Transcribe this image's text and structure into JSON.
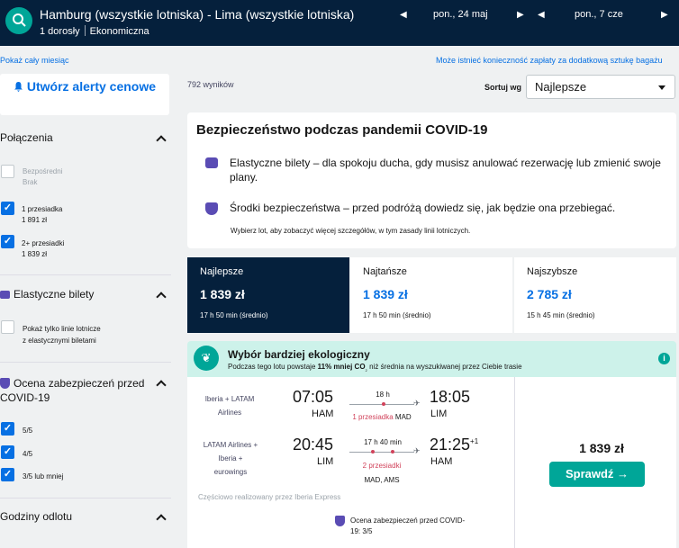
{
  "header": {
    "route": "Hamburg (wszystkie lotniska) - Lima (wszystkie lotniska)",
    "passengers": "1 dorosły",
    "cabin": "Ekonomiczna",
    "depart_date": "pon., 24 maj",
    "return_date": "pon., 7 cze"
  },
  "links": {
    "whole_month": "Pokaż cały miesiąc",
    "baggage": "Może istnieć konieczność zapłaty za dodatkową sztukę bagażu"
  },
  "sidebar": {
    "alert_button": "Utwórz alerty cenowe",
    "connections": {
      "title": "Połączenia",
      "options": [
        {
          "label": "Bezpośredni",
          "sub": "Brak",
          "checked": false
        },
        {
          "label": "1 przesiadka",
          "sub": "1 891 zł",
          "checked": true
        },
        {
          "label": "2+ przesiadki",
          "sub": "1 839 zł",
          "checked": true
        }
      ]
    },
    "flexible": {
      "title": "Elastyczne bilety",
      "option_line1": "Pokaż tylko linie lotnicze",
      "option_line2": "z elastycznymi biletami"
    },
    "covid": {
      "title_line1": "Ocena zabezpieczeń przed",
      "title_line2": "COVID-19",
      "options": [
        "5/5",
        "4/5",
        "3/5 lub mniej"
      ]
    },
    "departure_title": "Godziny odlotu"
  },
  "results": {
    "count": "792 wyników",
    "sort_label": "Sortuj wg",
    "sort_value": "Najlepsze"
  },
  "covid_card": {
    "title": "Bezpieczeństwo podczas pandemii COVID-19",
    "item1": "Elastyczne bilety – dla spokoju ducha, gdy musisz anulować rezerwację lub zmienić swoje plany.",
    "item2": "Środki bezpieczeństwa – przed podróżą dowiedz się, jak będzie ona przebiegać.",
    "note": "Wybierz lot, aby zobaczyć więcej szczegółów, w tym zasady linii lotniczych."
  },
  "tabs": [
    {
      "label": "Najlepsze",
      "price": "1 839 zł",
      "duration": "17 h 50 min (średnio)"
    },
    {
      "label": "Najtańsze",
      "price": "1 839 zł",
      "duration": "17 h 50 min (średnio)"
    },
    {
      "label": "Najszybsze",
      "price": "2 785 zł",
      "duration": "15 h 45 min (średnio)"
    }
  ],
  "eco": {
    "title": "Wybór bardziej ekologiczny",
    "sub_prefix": "Podczas tego lotu powstaje ",
    "sub_bold": "11% mniej CO",
    "sub_co2": "₂",
    "sub_suffix": " niż średnia na wyszukiwanej przez Ciebie trasie"
  },
  "flight": {
    "outbound": {
      "airline_line1": "Iberia + LATAM",
      "airline_line2": "Airlines",
      "dep_time": "07:05",
      "dep_airport": "HAM",
      "duration": "18 h",
      "stops": "1 przesiadka",
      "via": "MAD",
      "arr_time": "18:05",
      "arr_airport": "LIM"
    },
    "inbound": {
      "airline_line1": "LATAM Airlines +",
      "airline_line2": "Iberia +",
      "airline_line3": "eurowings",
      "dep_time": "20:45",
      "dep_airport": "LIM",
      "duration": "17 h 40 min",
      "stops": "2 przesiadki",
      "via": "MAD, AMS",
      "arr_time": "21:25",
      "arr_day_offset": "+1",
      "arr_airport": "HAM"
    },
    "operated_by": "Częściowo realizowany przez Iberia Express",
    "safety_line1": "Ocena zabezpieczeń przed COVID-",
    "safety_line2": "19: 3/5",
    "price": "1 839 zł",
    "cta": "Sprawdź →"
  },
  "colors": {
    "header_bg": "#05203c",
    "accent": "#0770e3",
    "teal": "#00a698",
    "eco_bg": "#cdf2ea",
    "stop_red": "#d1435b"
  }
}
